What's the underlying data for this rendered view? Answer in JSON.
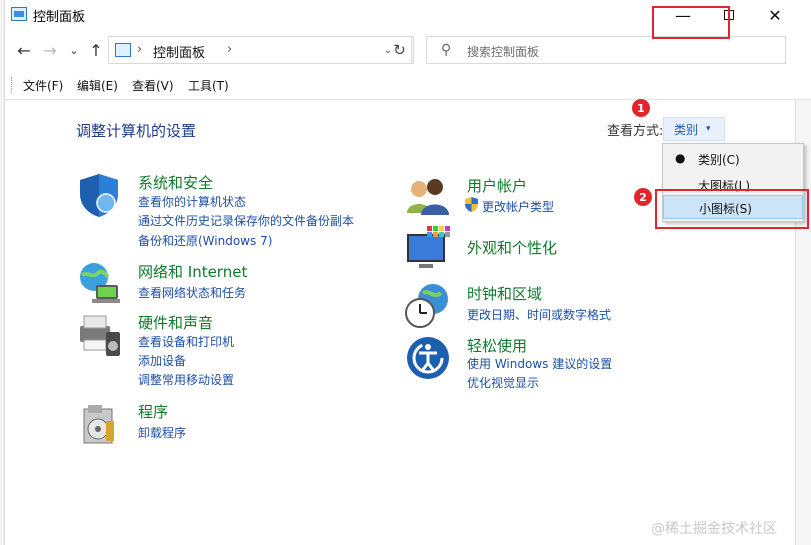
{
  "window": {
    "title": "控制面板",
    "min_glyph": "—",
    "close_glyph": "✕"
  },
  "nav": {
    "back_glyph": "←",
    "forward_glyph": "→",
    "dropdown_glyph": "⌄",
    "up_glyph": "↑",
    "address_sep": "›",
    "address_text": "控制面板",
    "address_chevron": "›",
    "address_dropdown_glyph": "⌄",
    "refresh_glyph": "↻",
    "search_placeholder": "搜索控制面板"
  },
  "menubar": {
    "file": "文件(F)",
    "edit": "编辑(E)",
    "view": "查看(V)",
    "tools": "工具(T)"
  },
  "content": {
    "page_title": "调整计算机的设置",
    "view_by_label": "查看方式:",
    "view_by_value": "类别",
    "view_by_caret": "▾"
  },
  "categories_left": [
    {
      "title": "系统和安全",
      "links": [
        "查看你的计算机状态",
        "通过文件历史记录保存你的文件备份副本",
        "备份和还原(Windows 7)"
      ]
    },
    {
      "title": "网络和 Internet",
      "links": [
        "查看网络状态和任务"
      ]
    },
    {
      "title": "硬件和声音",
      "links": [
        "查看设备和打印机",
        "添加设备",
        "调整常用移动设置"
      ]
    },
    {
      "title": "程序",
      "links": [
        "卸载程序"
      ]
    }
  ],
  "categories_right": [
    {
      "title": "用户帐户",
      "links": [
        "更改帐户类型"
      ]
    },
    {
      "title": "外观和个性化",
      "links": []
    },
    {
      "title": "时钟和区域",
      "links": [
        "更改日期、时间或数字格式"
      ]
    },
    {
      "title": "轻松使用",
      "links": [
        "使用 Windows 建议的设置",
        "优化视觉显示"
      ]
    }
  ],
  "dropdown": {
    "bullet": "●",
    "items": [
      "类别(C)",
      "大图标(L)",
      "小图标(S)"
    ]
  },
  "annotations": {
    "badge1": "1",
    "badge2": "2"
  },
  "watermark": "@稀土掘金技术社区",
  "colors": {
    "annotation_red": "#e0262d",
    "category_green": "#0f7a2a",
    "link_blue": "#1d4fa6",
    "title_blue": "#1f3d8a"
  }
}
